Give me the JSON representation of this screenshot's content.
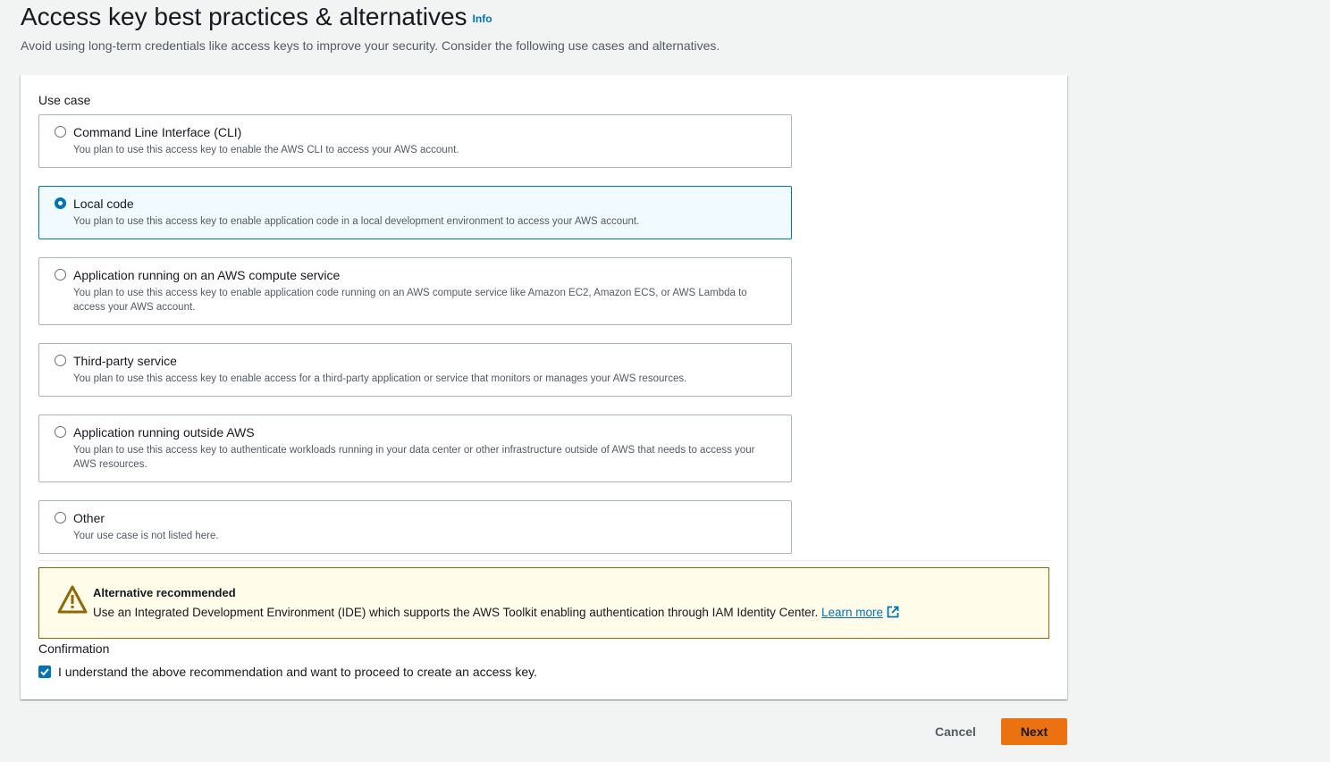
{
  "header": {
    "title": "Access key best practices & alternatives",
    "info_label": "Info",
    "description": "Avoid using long-term credentials like access keys to improve your security. Consider the following use cases and alternatives."
  },
  "use_case": {
    "label": "Use case",
    "selected": "Local code",
    "options": [
      {
        "title": "Command Line Interface (CLI)",
        "description": "You plan to use this access key to enable the AWS CLI to access your AWS account.",
        "selected": false
      },
      {
        "title": "Local code",
        "description": "You plan to use this access key to enable application code in a local development environment to access your AWS account.",
        "selected": true
      },
      {
        "title": "Application running on an AWS compute service",
        "description": "You plan to use this access key to enable application code running on an AWS compute service like Amazon EC2, Amazon ECS, or AWS Lambda to access your AWS account.",
        "selected": false
      },
      {
        "title": "Third-party service",
        "description": "You plan to use this access key to enable access for a third-party application or service that monitors or manages your AWS resources.",
        "selected": false
      },
      {
        "title": "Application running outside AWS",
        "description": "You plan to use this access key to authenticate workloads running in your data center or other infrastructure outside of AWS that needs to access your AWS resources.",
        "selected": false
      },
      {
        "title": "Other",
        "description": "Your use case is not listed here.",
        "selected": false
      }
    ]
  },
  "alert": {
    "title": "Alternative recommended",
    "text": "Use an Integrated Development Environment (IDE) which supports the AWS Toolkit enabling authentication through IAM Identity Center.",
    "link_label": "Learn more",
    "icon": "warning-icon"
  },
  "confirmation": {
    "label": "Confirmation",
    "checkbox_label": "I understand the above recommendation and want to proceed to create an access key.",
    "checked": true
  },
  "footer": {
    "cancel_label": "Cancel",
    "next_label": "Next"
  },
  "colors": {
    "accent": "#0073bb",
    "primary_button": "#ec7211",
    "warning_border": "#906806",
    "warning_bg": "#fffce9"
  }
}
